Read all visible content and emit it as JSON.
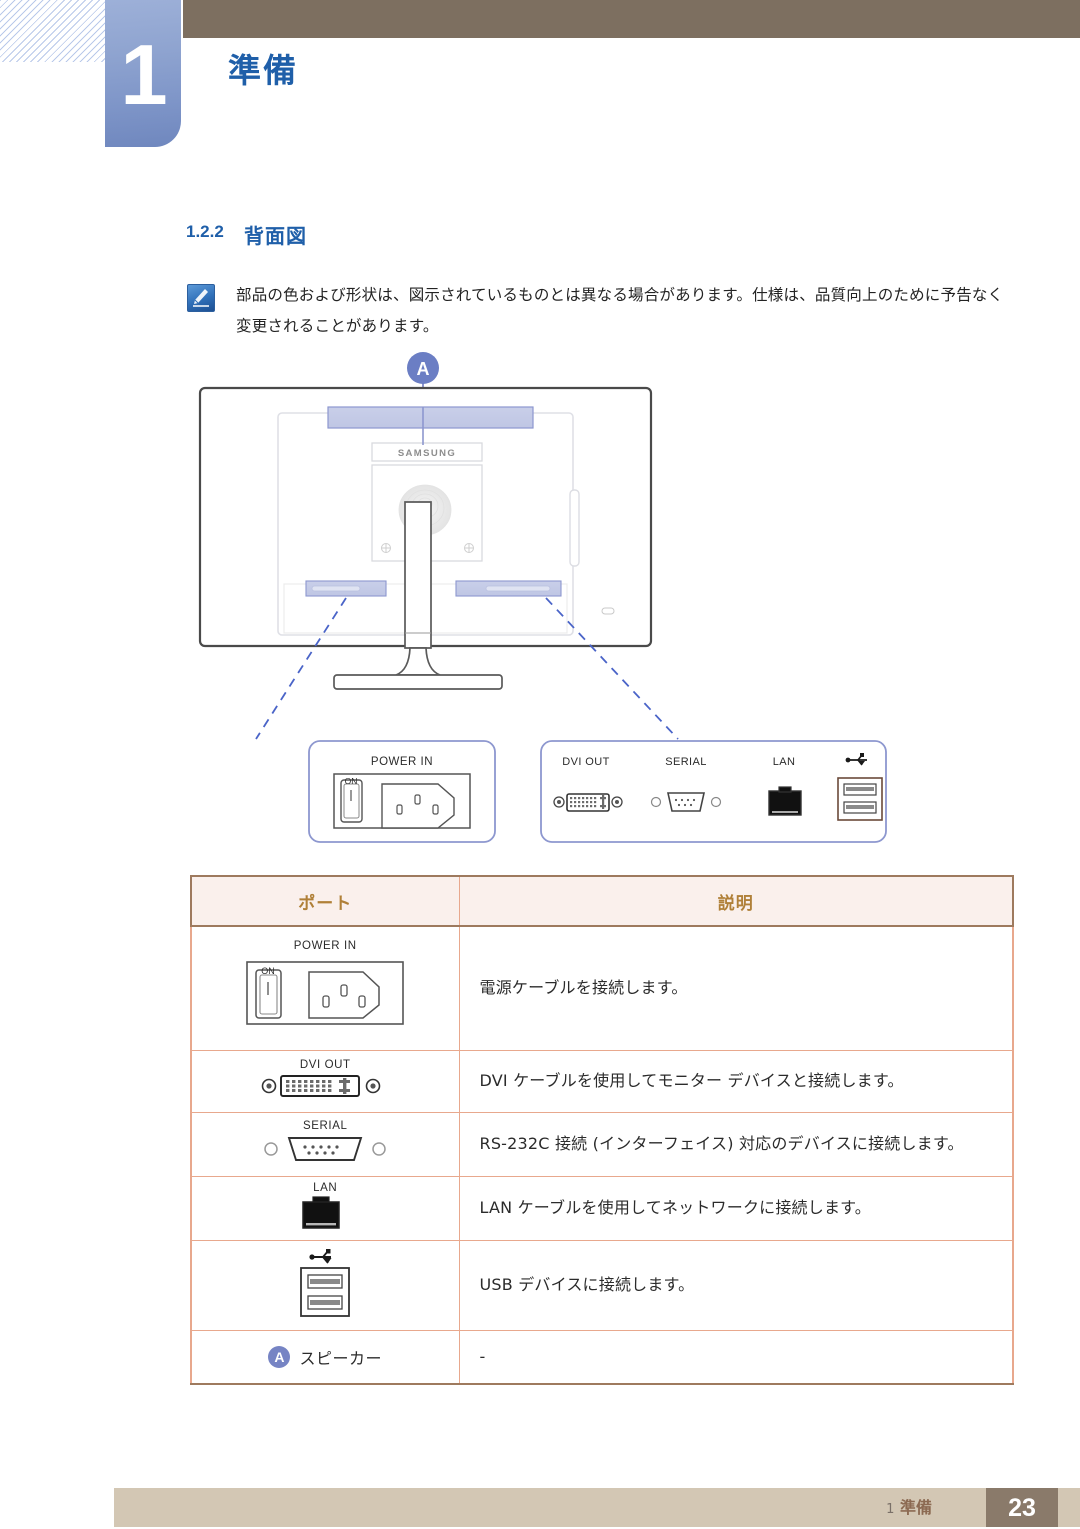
{
  "chapter": {
    "number": "1",
    "title": "準備"
  },
  "section": {
    "number": "1.2.2",
    "title": "背面図"
  },
  "note": {
    "icon": "note-pencil-icon",
    "text": "部品の色および形状は、図示されているものとは異なる場合があります。仕様は、品質向上のために予告なく変更されることがあります。"
  },
  "diagram": {
    "callout_badge": "A",
    "brand_logo": "SAMSUNG",
    "left_box_label": "POWER IN",
    "power_switch_label": "ON",
    "right_box_labels": [
      "DVI OUT",
      "SERIAL",
      "LAN"
    ],
    "usb_icon": "usb-icon"
  },
  "table": {
    "headers": [
      "ポート",
      "説明"
    ],
    "rows": [
      {
        "port_label": "POWER IN",
        "switch_label": "ON",
        "icon": "power-in-icon",
        "description": "電源ケーブルを接続します。"
      },
      {
        "port_label": "DVI OUT",
        "switch_label": "",
        "icon": "dvi-port-icon",
        "description": "DVI ケーブルを使用してモニター デバイスと接続します。"
      },
      {
        "port_label": "SERIAL",
        "switch_label": "",
        "icon": "serial-port-icon",
        "description": "RS-232C 接続 (インターフェイス) 対応のデバイスに接続します。"
      },
      {
        "port_label": "LAN",
        "switch_label": "",
        "icon": "lan-port-icon",
        "description": "LAN ケーブルを使用してネットワークに接続します。"
      },
      {
        "port_label": "",
        "switch_label": "",
        "icon": "usb-port-icon",
        "description": "USB デバイスに接続します。"
      },
      {
        "port_label": "スピーカー",
        "badge": "A",
        "icon": "speaker-badge",
        "description": "-"
      }
    ]
  },
  "footer": {
    "chapter_number": "1",
    "chapter_title": "準備",
    "page_number": "23"
  },
  "colors": {
    "accent_blue": "#1f5fa9",
    "tab_blue": "#7e95c8",
    "badge_purple": "#7684c4",
    "highlight_fill": "#c3c9e8",
    "table_border": "#e8a88d",
    "table_header_bg": "#faf0ec",
    "table_header_text": "#b08038",
    "footer_bar": "#d3c7b4",
    "footer_page_bg": "#8a7a6a",
    "brown_bar": "#7d6f60"
  }
}
